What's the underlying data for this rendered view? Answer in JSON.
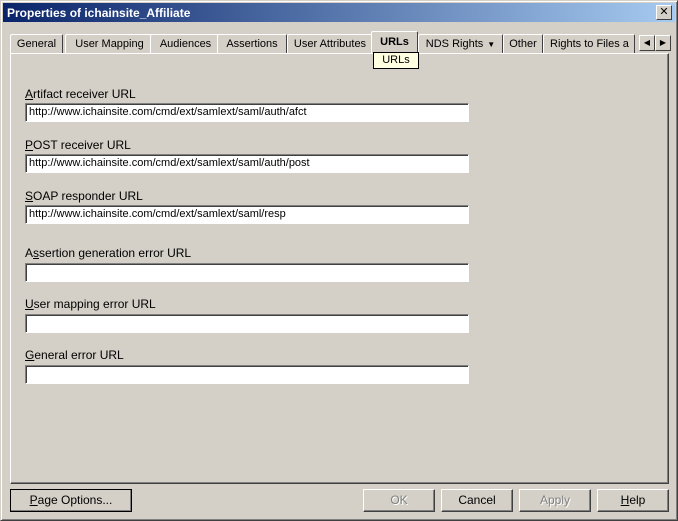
{
  "window": {
    "title": "Properties of ichainsite_Affiliate",
    "close_glyph": "✕"
  },
  "tabs": [
    {
      "label": "General"
    },
    {
      "label": "User Mapping"
    },
    {
      "label": "Audiences"
    },
    {
      "label": "Assertions"
    },
    {
      "label": "User Attributes"
    },
    {
      "label": "URLs"
    },
    {
      "label": "NDS Rights"
    },
    {
      "label": "Other"
    },
    {
      "label": "Rights to Files a"
    }
  ],
  "tooltip": "URLs",
  "fields": [
    {
      "label_key": "A",
      "label_rest": "rtifact receiver URL",
      "value": "http://www.ichainsite.com/cmd/ext/samlext/saml/auth/afct"
    },
    {
      "label_key": "P",
      "label_rest": "OST receiver URL",
      "value": "http://www.ichainsite.com/cmd/ext/samlext/saml/auth/post"
    },
    {
      "label_key": "S",
      "label_rest": "OAP responder URL",
      "value": "http://www.ichainsite.com/cmd/ext/samlext/saml/resp"
    },
    {
      "label_pre": "A",
      "label_key": "s",
      "label_rest": "sertion generation error URL",
      "value": ""
    },
    {
      "label_pre": "",
      "label_key": "U",
      "label_rest": "ser mapping error URL",
      "value": ""
    },
    {
      "label_pre": "",
      "label_key": "G",
      "label_rest": "eneral error URL",
      "value": ""
    }
  ],
  "buttons": {
    "page_options_key": "P",
    "page_options_rest": "age Options...",
    "ok": "OK",
    "cancel": "Cancel",
    "apply": "Apply",
    "help_key": "H",
    "help_rest": "elp"
  }
}
